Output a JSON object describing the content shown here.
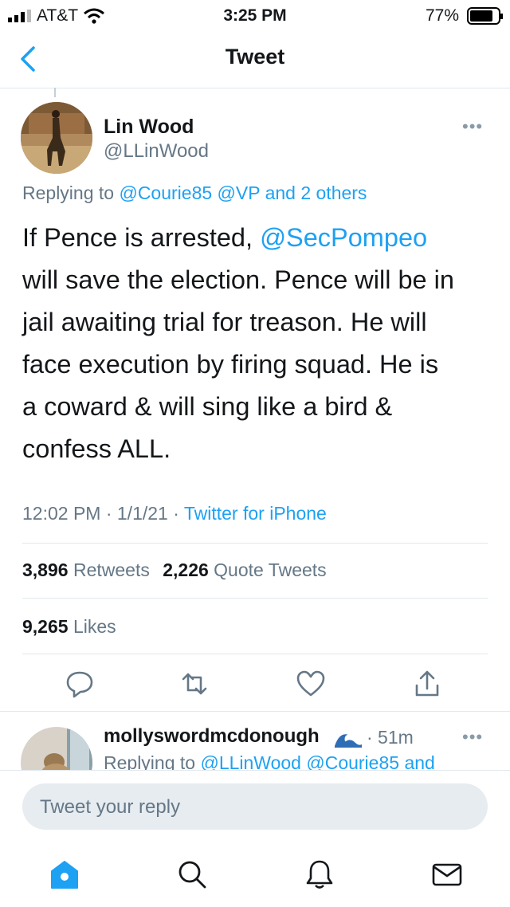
{
  "status_bar": {
    "carrier": "AT&T",
    "time": "3:25 PM",
    "battery": "77%"
  },
  "nav": {
    "title": "Tweet"
  },
  "tweet": {
    "author_name": "Lin Wood",
    "author_handle": "@LLinWood",
    "replying_prefix": "Replying to ",
    "replying_mention_1": "@Courie85",
    "replying_mention_2": "@VP",
    "replying_more": "and 2 others",
    "text_lines": [
      {
        "pre": "If Pence is arrested, ",
        "mention": "@SecPompeo"
      },
      {
        "pre": "will save the election. Pence will be in"
      },
      {
        "pre": "jail awaiting trial for treason. He will"
      },
      {
        "pre": "face execution by firing squad. He is"
      },
      {
        "pre": "a coward & will sing like a bird &"
      },
      {
        "pre": "confess ALL."
      }
    ],
    "timestamp": "12:02 PM · 1/1/21 · ",
    "source": "Twitter for iPhone",
    "retweets_count": "3,896",
    "retweets_label": "Retweets",
    "quote_count": "2,226",
    "quote_label": "Quote Tweets",
    "likes_count": "9,265",
    "likes_label": "Likes"
  },
  "reply": {
    "author_name": "mollyswordmcdonough",
    "time": "· 51m",
    "replying_prefix": "Replying to ",
    "replying_mention_1": "@LLinWood",
    "replying_mention_2": "@Courie85",
    "replying_more": "and"
  },
  "composer": {
    "placeholder": "Tweet your reply"
  },
  "icons": {
    "reply": "reply-icon",
    "retweet": "retweet-icon",
    "like": "heart-icon",
    "share": "share-icon",
    "home": "home-icon",
    "search": "search-icon",
    "notifications": "bell-icon",
    "messages": "mail-icon"
  },
  "colors": {
    "accent": "#1da1f2",
    "text": "#14171a",
    "secondary": "#657786"
  }
}
